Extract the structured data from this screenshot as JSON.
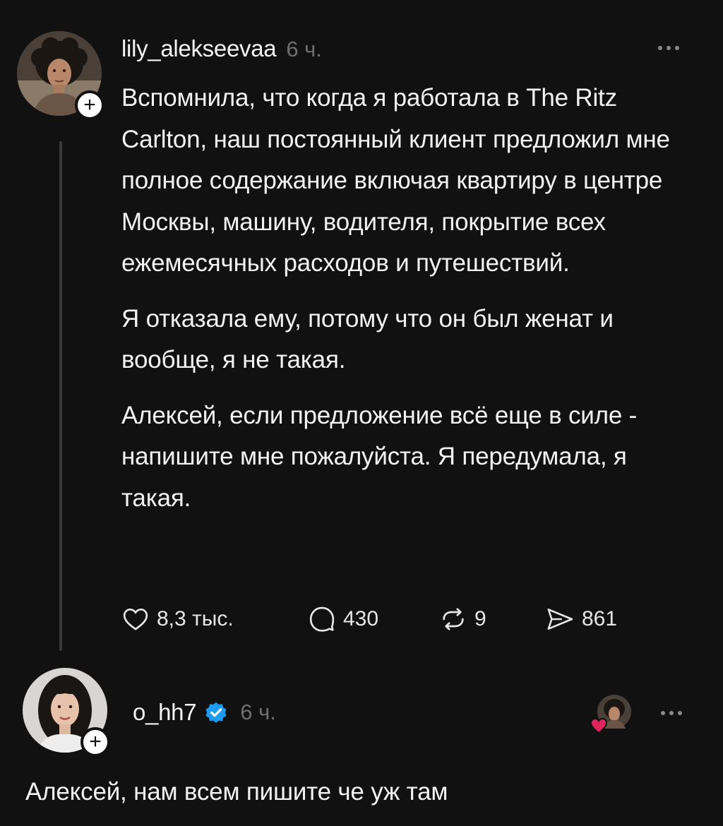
{
  "post": {
    "username": "lily_alekseevaa",
    "time": "6 ч.",
    "paragraphs": [
      "Вспомнила, что когда я работала в The Ritz Carlton, наш постоянный клиент предложил мне полное содержание включая квартиру в центре Москвы, машину, водителя, покрытие всех ежемесячных расходов и путешествий.",
      "Я отказала ему, потому что он был женат и вообще, я не такая.",
      "Алексей, если предложение всё еще в силе - напишите мне пожалуйста. Я передумала, я такая."
    ],
    "actions": {
      "likes": "8,3 тыс.",
      "comments": "430",
      "reposts": "9",
      "shares": "861"
    }
  },
  "reply": {
    "username": "o_hh7",
    "time": "6 ч.",
    "text": "Алексей, нам всем пишите че уж там"
  },
  "icons": {
    "follow": "plus-icon",
    "more": "more-horizontal-icon",
    "like": "heart-outline-icon",
    "comment": "speech-bubble-icon",
    "repost": "repost-arrows-icon",
    "share": "send-icon",
    "verified": "verified-badge-icon"
  },
  "colors": {
    "background": "#111111",
    "text": "#f2f2f2",
    "muted": "#6f6f6f",
    "verified": "#1d9bf0",
    "heart": "#e0245e"
  }
}
